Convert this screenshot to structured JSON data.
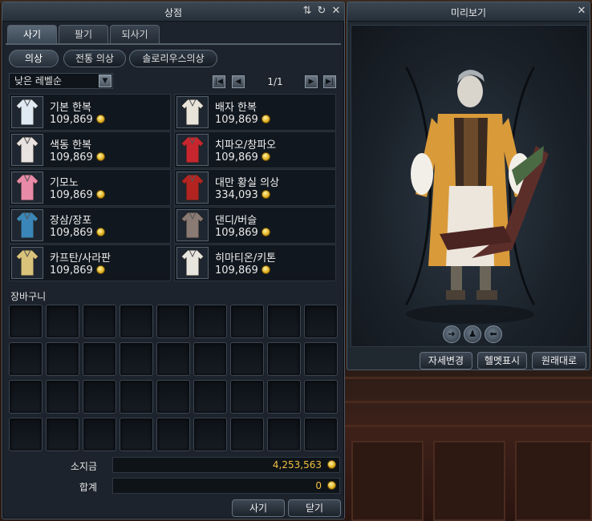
{
  "shop": {
    "title": "상점",
    "tabs": [
      {
        "label": "사기"
      },
      {
        "label": "팔기"
      },
      {
        "label": "되사기"
      }
    ],
    "categories": [
      {
        "label": "의상"
      },
      {
        "label": "전통 의상"
      },
      {
        "label": "솔로리우스의상"
      }
    ],
    "sort": {
      "selected": "낮은 레벨순"
    },
    "pager": {
      "text": "1/1"
    },
    "items": [
      {
        "name": "기본 한복",
        "price": "109,869",
        "icon": "white-hanbok-icon",
        "color": "#dfe9f2"
      },
      {
        "name": "배자 한복",
        "price": "109,869",
        "icon": "baeja-hanbok-icon",
        "color": "#e9e4da"
      },
      {
        "name": "색동 한복",
        "price": "109,869",
        "icon": "saekdong-hanbok-icon",
        "color": "#e8e2e0"
      },
      {
        "name": "치파오/창파오",
        "price": "109,869",
        "icon": "qipao-icon",
        "color": "#c8262e"
      },
      {
        "name": "기모노",
        "price": "109,869",
        "icon": "kimono-icon",
        "color": "#e88aa8"
      },
      {
        "name": "대만 황실 의상",
        "price": "334,093",
        "icon": "taiwan-royal-dress-icon",
        "color": "#b32420"
      },
      {
        "name": "장삼/장포",
        "price": "109,869",
        "icon": "changshan-icon",
        "color": "#3a86b8"
      },
      {
        "name": "댄디/버슬",
        "price": "109,869",
        "icon": "dandy-bustle-icon",
        "color": "#8a7a74"
      },
      {
        "name": "카프탄/사라판",
        "price": "109,869",
        "icon": "kaftan-sarafan-icon",
        "color": "#d9c27a"
      },
      {
        "name": "히마티온/키톤",
        "price": "109,869",
        "icon": "himation-chiton-icon",
        "color": "#e8e4de"
      }
    ],
    "cart": {
      "label": "장바구니"
    },
    "money": {
      "label": "소지금",
      "value": "4,253,563"
    },
    "total": {
      "label": "합계",
      "value": "0"
    },
    "buy_label": "사기",
    "close_label": "닫기"
  },
  "preview": {
    "title": "미리보기",
    "pose_label": "자세변경",
    "helmet_label": "헬멧표시",
    "reset_label": "원래대로"
  },
  "colors": {
    "price_gold": "#f0c040",
    "coat": "#d99a3a"
  }
}
